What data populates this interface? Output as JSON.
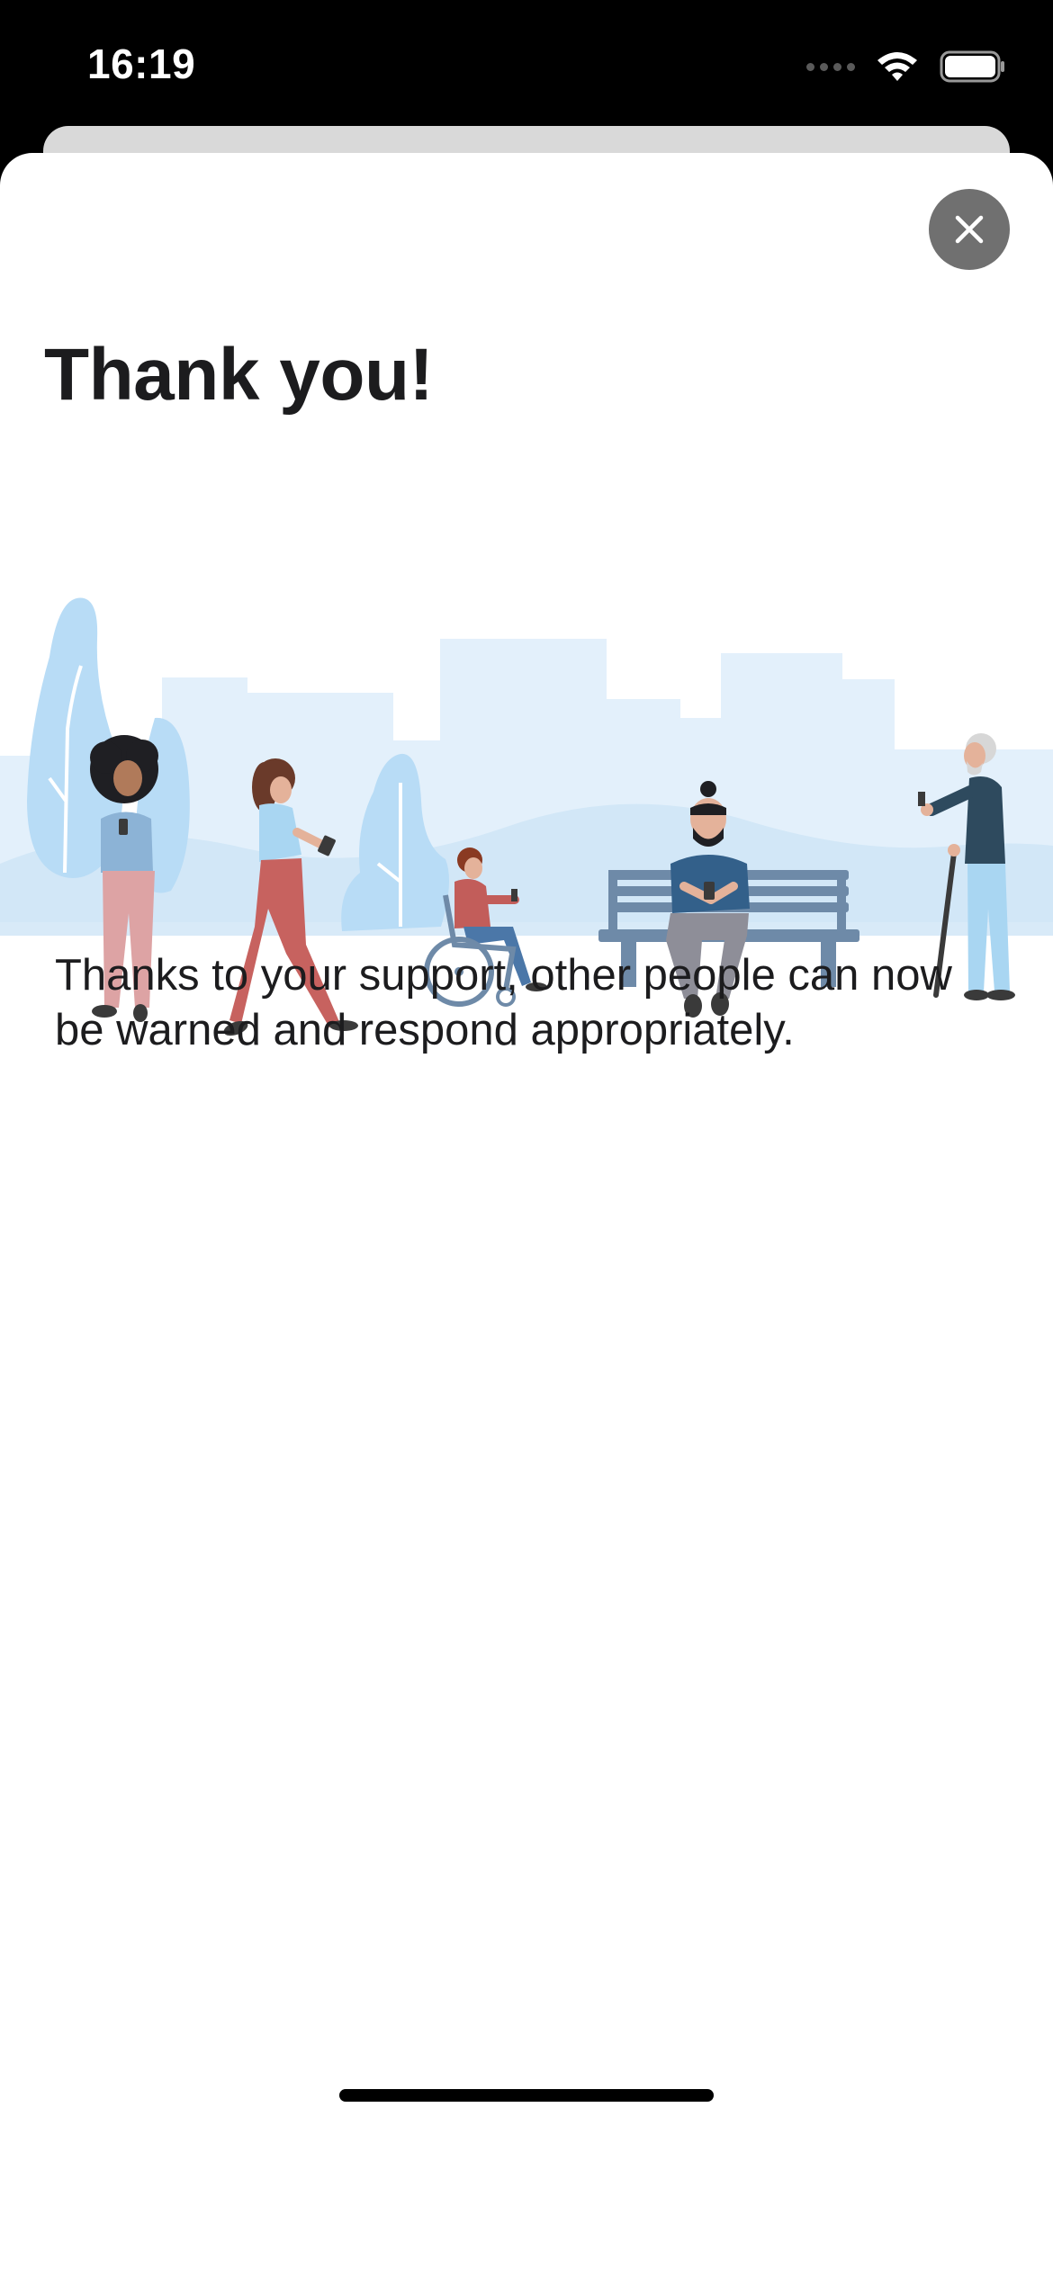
{
  "status_bar": {
    "time": "16:19",
    "icons": [
      "signal-dots-icon",
      "wifi-icon",
      "battery-icon"
    ]
  },
  "sheet": {
    "close_icon": "close-icon",
    "title": "Thank you!",
    "message": "Thanks to your support, other people can now be warned and respond appropriately."
  },
  "colors": {
    "sheet_background": "#ffffff",
    "close_button": "#707070",
    "text": "#1c1c1e",
    "illustration_sky": "#e3f0fb",
    "illustration_tree": "#b8dcf6"
  }
}
